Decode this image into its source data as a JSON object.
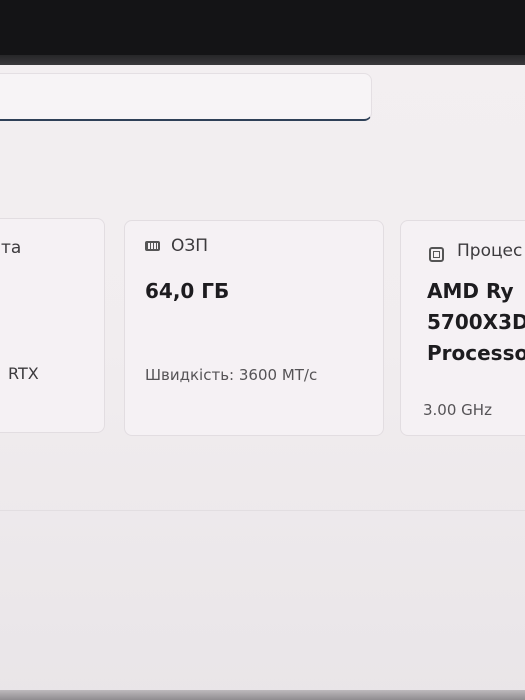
{
  "gpu_card": {
    "title_fragment": "та",
    "detail_fragment": "RTX"
  },
  "ram_card": {
    "icon": "ram-icon",
    "title": "ОЗП",
    "value": "64,0 ГБ",
    "speed": "Швидкість: 3600 МТ/с"
  },
  "cpu_card": {
    "icon": "cpu-icon",
    "title_fragment": "Процес",
    "value_line1": "AMD Ry",
    "value_line2": "5700X3D",
    "value_line3": "Processo",
    "frequency": "3.00 GHz"
  }
}
